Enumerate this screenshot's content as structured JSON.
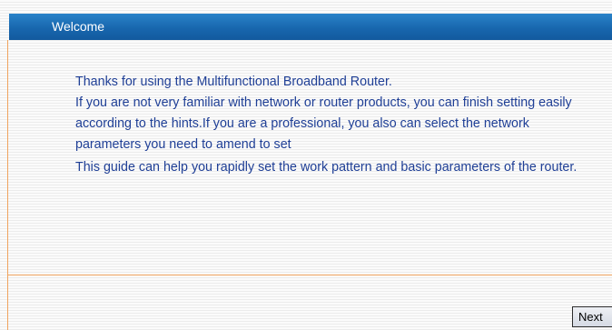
{
  "header": {
    "title": "Welcome"
  },
  "intro": {
    "line1": "Thanks for using the Multifunctional Broadband Router.",
    "para2": "If you are not very familiar with network or router products, you can finish setting easily according to the hints.If you are a professional, you also can select the network parameters you need to amend to set",
    "para3": "This guide can help you rapidly set the work pattern and basic parameters of the router."
  },
  "footer": {
    "next_label": "Next"
  },
  "colors": {
    "header_bar": "#1867ae",
    "body_text": "#1f3f96",
    "accent_rule": "#f0a35e"
  }
}
